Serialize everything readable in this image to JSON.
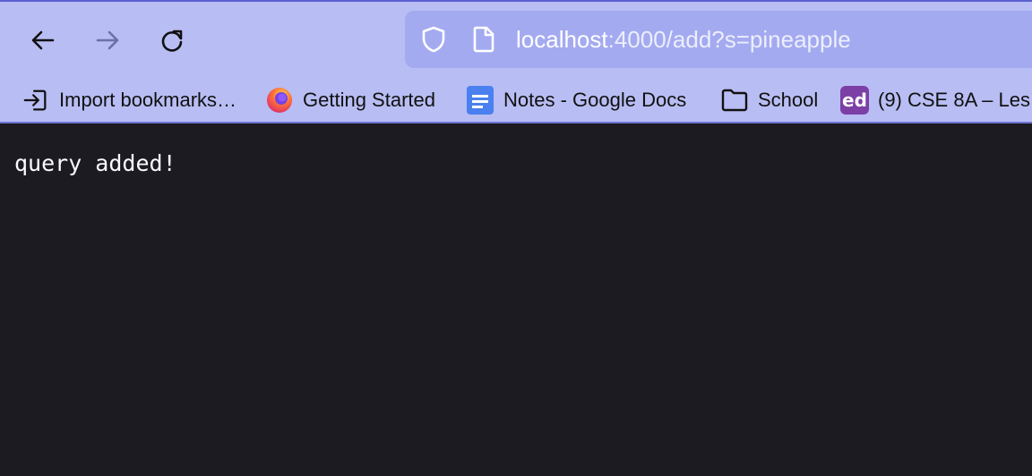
{
  "browser": {
    "url_host": "localhost",
    "url_path": ":4000/add?s=pineapple"
  },
  "bookmarks": [
    {
      "label": "Import bookmarks…",
      "icon": "import-icon"
    },
    {
      "label": "Getting Started",
      "icon": "firefox-icon"
    },
    {
      "label": "Notes - Google Docs",
      "icon": "google-docs-icon"
    },
    {
      "label": "School",
      "icon": "folder-icon"
    },
    {
      "label": "(9) CSE 8A – Les",
      "icon": "ed-icon",
      "icon_text": "ed"
    }
  ],
  "page": {
    "body_text": "query added!"
  },
  "colors": {
    "toolbar": "#b8bdf3",
    "urlbar": "#a4aaf0",
    "content_bg": "#1c1b22"
  }
}
